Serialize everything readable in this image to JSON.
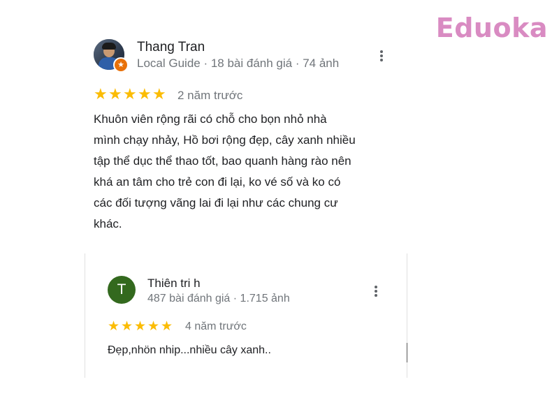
{
  "watermark": {
    "text": "Eduoka",
    "color": "#d98bc2"
  },
  "reviews": [
    {
      "author": "Thang Tran",
      "meta": "Local Guide · 18 bài đánh giá · 74 ảnh",
      "rating": 5,
      "date": "2 năm trước",
      "lines": [
        "Khuôn viên rộng rãi có chỗ cho bọn nhỏ nhà",
        "mình chạy nhảy, Hồ bơi rộng đẹp, cây xanh nhiều",
        "tập thể dục thể thao tốt, bao quanh hàng rào nên",
        "khá an tâm cho trẻ con đi lại, ko vé số và ko có",
        "các đối tượng vãng lai đi lại như các chung cư",
        "khác."
      ],
      "avatar": "profile-photo",
      "badge_icon": "local-guide-star-icon"
    },
    {
      "author": "Thiên tri h",
      "meta": "487 bài đánh giá · 1.715 ảnh",
      "rating": 5,
      "date": "4 năm trước",
      "text": "Đẹp,nhön nhip...nhiều cây xanh..",
      "avatar_letter": "T",
      "avatar_color": "#33691e"
    }
  ],
  "colors": {
    "star": "#fbbc04",
    "secondary_text": "#70757a",
    "badge": "#e8710a"
  },
  "icons": {
    "more": "more-vert-icon",
    "star": "star-icon"
  }
}
